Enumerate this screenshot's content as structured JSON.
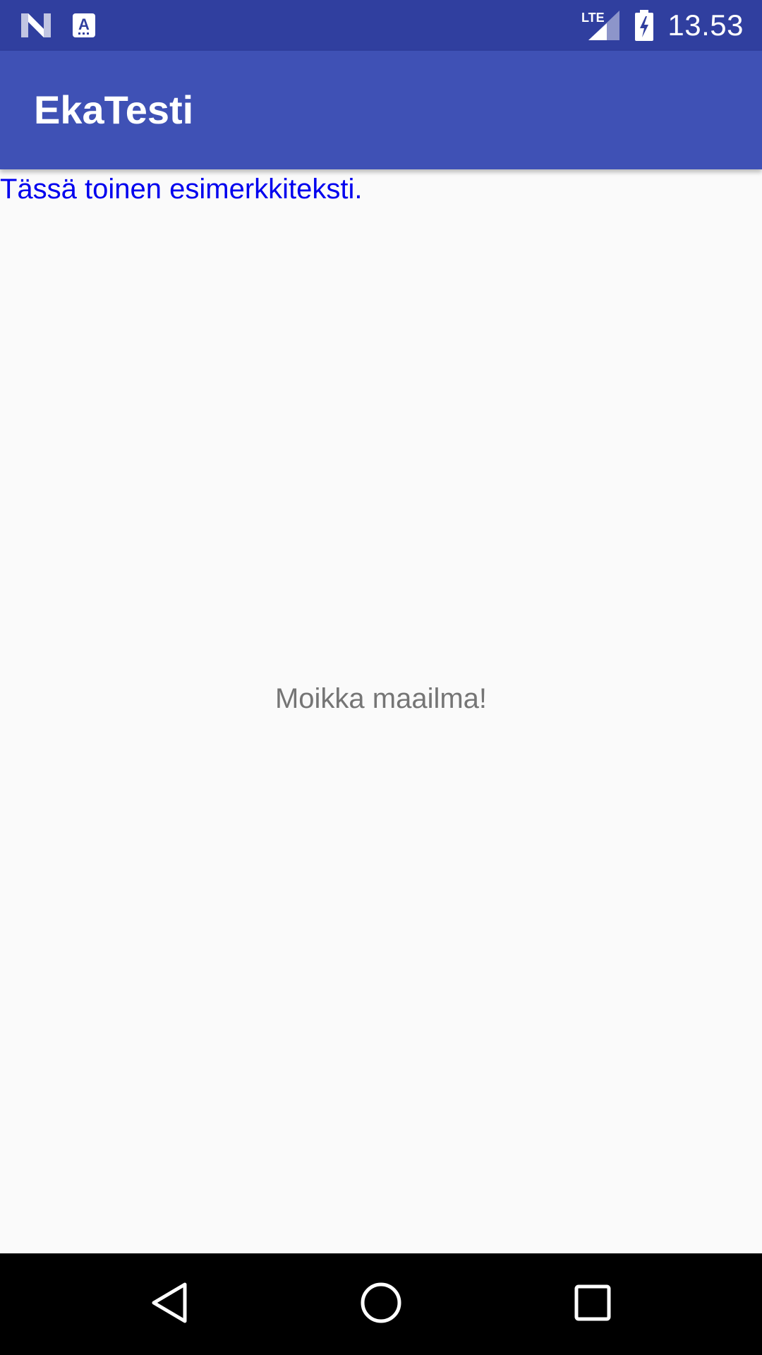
{
  "status_bar": {
    "left_icons": [
      "notification-n-icon",
      "keyboard-a-icon"
    ],
    "right_icons": [
      "lte-signal-icon",
      "battery-charging-icon"
    ],
    "network_label": "LTE",
    "time": "13.53"
  },
  "app_bar": {
    "title": "EkaTesti",
    "color": "#3f51b5"
  },
  "content": {
    "secondary_text": "Tässä toinen esimerkkiteksti.",
    "secondary_text_color": "#0000ee",
    "center_text": "Moikka maailma!"
  },
  "nav_bar": {
    "buttons": [
      "back-icon",
      "home-icon",
      "recents-icon"
    ]
  }
}
